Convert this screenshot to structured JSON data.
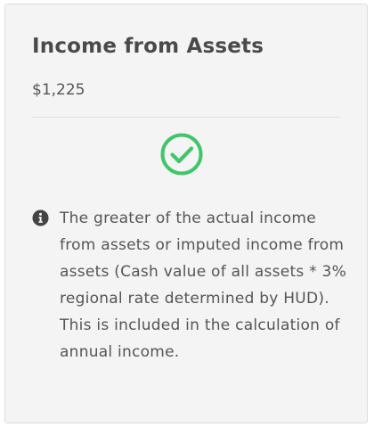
{
  "card": {
    "title": "Income from Assets",
    "amount": "$1,225",
    "status_icon": "check-circle-icon",
    "info_icon": "info-circle-icon",
    "info_text": "The greater of the actual income from assets or imputed income from assets (Cash value of all assets * 3% regional rate determined by HUD). This is included in the calculation of annual income."
  },
  "colors": {
    "card_background": "#f4f4f4",
    "check_green": "#3ec76a",
    "text": "#555555",
    "icon_dark": "#444444"
  }
}
